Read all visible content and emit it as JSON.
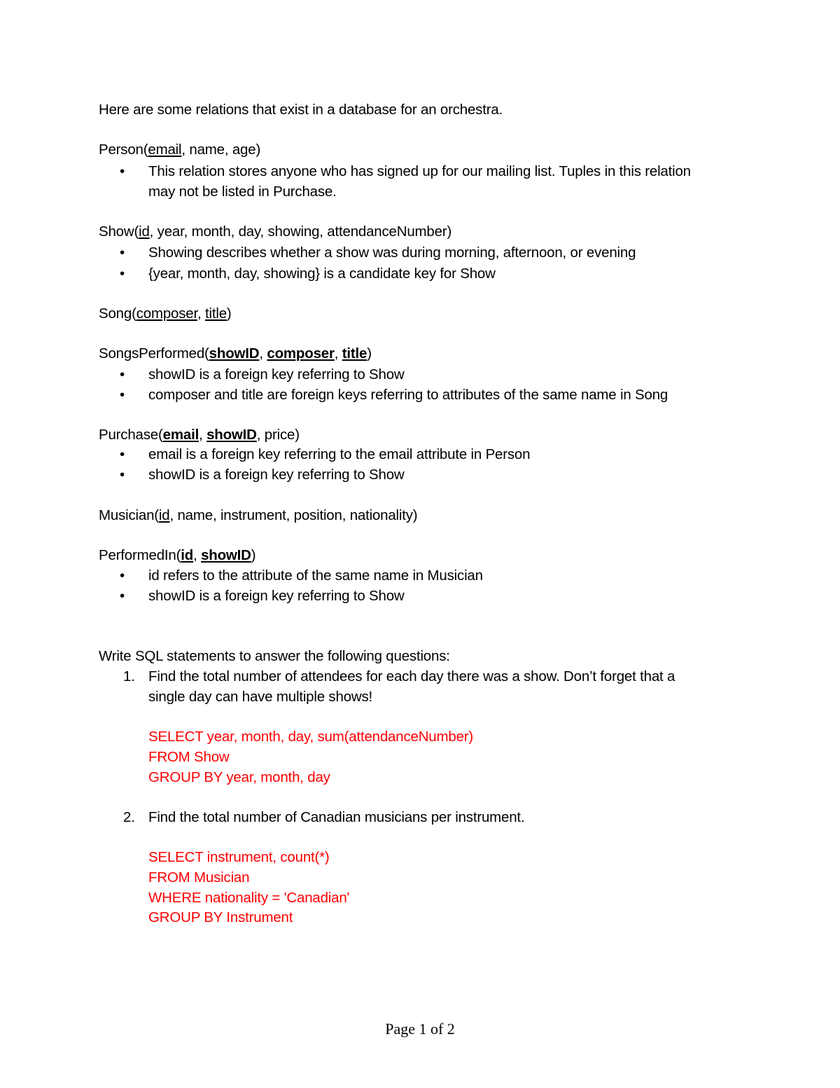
{
  "intro": "Here are some relations that exist in a database for an orchestra.",
  "relations": {
    "person": {
      "name": "Person(",
      "attrs": [
        {
          "text": "email",
          "style": "underline"
        },
        {
          "text": ", name, age)",
          "style": "plain"
        }
      ],
      "bullets": [
        "This relation stores anyone who has signed up for our mailing list. Tuples in this relation",
        "may not be listed in Purchase."
      ]
    },
    "show": {
      "name": "Show(",
      "attrs": [
        {
          "text": "id",
          "style": "underline"
        },
        {
          "text": ", year, month, day, showing, attendanceNumber)",
          "style": "plain"
        }
      ],
      "bullets": [
        "Showing describes whether a show was during morning, afternoon, or evening",
        "{year, month, day, showing} is a candidate key for Show"
      ]
    },
    "song": {
      "name": "Song(",
      "attrs": [
        {
          "text": "composer",
          "style": "underline"
        },
        {
          "text": ", ",
          "style": "plain"
        },
        {
          "text": "title",
          "style": "underline"
        },
        {
          "text": ")",
          "style": "plain"
        }
      ]
    },
    "songs_performed": {
      "name": "SongsPerformed(",
      "attrs": [
        {
          "text": "showID",
          "style": "underline-bold"
        },
        {
          "text": ", ",
          "style": "plain"
        },
        {
          "text": "composer",
          "style": "underline-bold"
        },
        {
          "text": ", ",
          "style": "plain"
        },
        {
          "text": "title",
          "style": "underline-bold"
        },
        {
          "text": ")",
          "style": "plain"
        }
      ],
      "bullets": [
        "showID is a foreign key referring to Show",
        "composer and title are foreign keys referring to attributes of the same name in Song"
      ]
    },
    "purchase": {
      "name": "Purchase(",
      "attrs": [
        {
          "text": "email",
          "style": "underline-bold"
        },
        {
          "text": ", ",
          "style": "plain"
        },
        {
          "text": "showID",
          "style": "underline-bold"
        },
        {
          "text": ", price)",
          "style": "plain"
        }
      ],
      "bullets": [
        "email is a foreign key referring to the email attribute in Person",
        "showID is a foreign key referring to Show"
      ]
    },
    "musician": {
      "name": "Musician(",
      "attrs": [
        {
          "text": "id",
          "style": "underline"
        },
        {
          "text": ", name, instrument, position, nationality)",
          "style": "plain"
        }
      ]
    },
    "performed_in": {
      "name": "PerformedIn(",
      "attrs": [
        {
          "text": "id",
          "style": "underline-bold"
        },
        {
          "text": ", ",
          "style": "plain"
        },
        {
          "text": "showID",
          "style": "underline-bold"
        },
        {
          "text": ")",
          "style": "plain"
        }
      ],
      "bullets": [
        "id refers to the attribute of the same name in Musician",
        "showID is a foreign key referring to Show"
      ]
    }
  },
  "bullet_glyph": "•",
  "questions_intro": "Write SQL statements to answer the following questions:",
  "questions": [
    {
      "number": "1.",
      "text_lines": [
        "Find the total number of attendees for each day there was a show. Don’t forget that a",
        "single day can have multiple shows!"
      ],
      "answer_lines": [
        "SELECT year, month, day, sum(attendanceNumber)",
        "FROM Show",
        "GROUP BY year, month, day"
      ]
    },
    {
      "number": "2.",
      "text_lines": [
        "Find the total number of Canadian musicians per instrument."
      ],
      "answer_lines": [
        "SELECT instrument, count(*)",
        "FROM Musician",
        "WHERE nationality = 'Canadian'",
        "GROUP BY Instrument"
      ]
    }
  ],
  "answer_color": "#ff0000",
  "footer": "Page 1 of 2"
}
